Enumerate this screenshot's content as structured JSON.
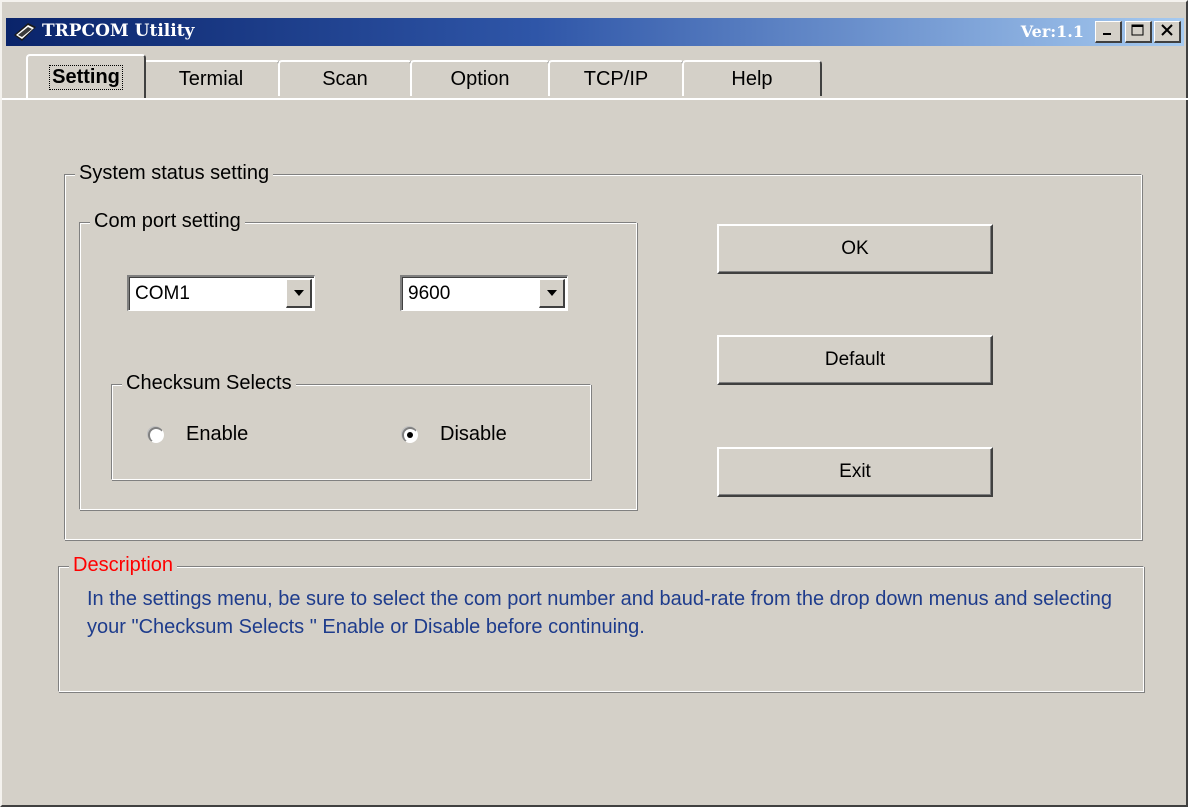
{
  "window": {
    "title": "TRPCOM Utility",
    "version": "Ver:1.1",
    "buttons": [
      "minimize",
      "maximize",
      "close"
    ]
  },
  "tabs": [
    {
      "label": "Setting",
      "active": true
    },
    {
      "label": "Termial",
      "active": false
    },
    {
      "label": "Scan",
      "active": false
    },
    {
      "label": "Option",
      "active": false
    },
    {
      "label": "TCP/IP",
      "active": false
    },
    {
      "label": "Help",
      "active": false
    }
  ],
  "system_group": {
    "label": "System status setting",
    "com_group": {
      "label": "Com port setting",
      "port_value": "COM1",
      "baud_value": "9600"
    },
    "checksum_group": {
      "label": "Checksum Selects",
      "enable_label": "Enable",
      "disable_label": "Disable",
      "selected": "Disable"
    }
  },
  "buttons": {
    "ok": "OK",
    "default": "Default",
    "exit": "Exit"
  },
  "description": {
    "label": "Description",
    "text": "In the settings menu, be sure to select the com port number and baud-rate from the drop down menus and selecting your \"Checksum Selects \" Enable or Disable before continuing."
  },
  "colors": {
    "title_bar_start": "#0a246a",
    "title_bar_end": "#a6caf0",
    "window_face": "#d4d0c8",
    "description_label": "#ff0000",
    "description_text": "#1e3c8c"
  }
}
